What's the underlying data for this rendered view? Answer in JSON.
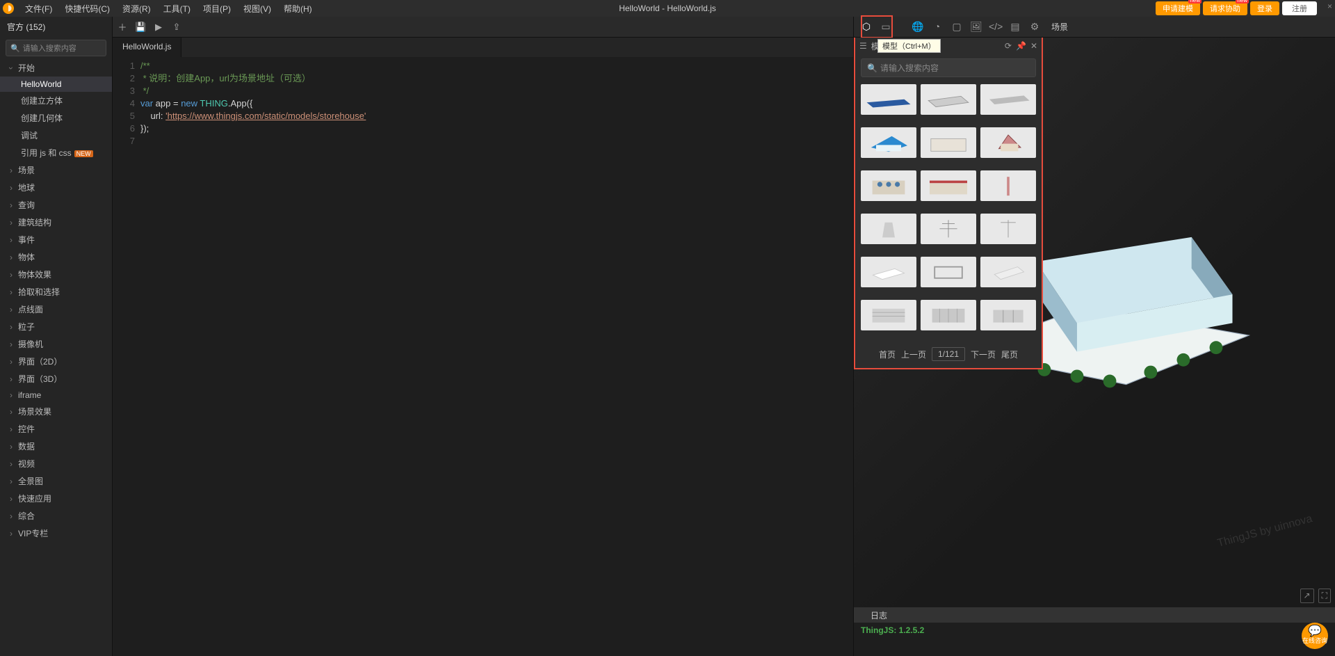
{
  "menubar": {
    "items": [
      "文件(F)",
      "快捷代码(C)",
      "资源(R)",
      "工具(T)",
      "项目(P)",
      "视图(V)",
      "帮助(H)"
    ],
    "title": "HelloWorld - HelloWorld.js",
    "btns": {
      "model": "申请建模",
      "help": "请求协助",
      "login": "登录",
      "signup": "注册",
      "new": "new"
    }
  },
  "sidebar": {
    "top": "官方 (152)",
    "search_ph": "请输入搜索内容",
    "begin_label": "开始",
    "begin_children": [
      {
        "label": "HelloWorld",
        "selected": true
      },
      {
        "label": "创建立方体"
      },
      {
        "label": "创建几何体"
      },
      {
        "label": "调试"
      },
      {
        "label": "引用 js 和 css",
        "new": true
      }
    ],
    "groups": [
      "场景",
      "地球",
      "查询",
      "建筑结构",
      "事件",
      "物体",
      "物体效果",
      "拾取和选择",
      "点线面",
      "粒子",
      "摄像机",
      "界面（2D）",
      "界面（3D）",
      "iframe",
      "场景效果",
      "控件",
      "数据",
      "视频",
      "全景图",
      "快速应用",
      "综合",
      "VIP专栏"
    ]
  },
  "editor": {
    "tab": "HelloWorld.js",
    "lines": [
      "1",
      "2",
      "3",
      "4",
      "5",
      "6",
      "7"
    ],
    "code": {
      "c1": "/**",
      "c2": " * 说明：创建App，url为场景地址（可选）",
      "c3": " */",
      "k_var": "var",
      "v_app": " app = ",
      "k_new": "new",
      "v_thing": " THING",
      "v_app2": ".App({",
      "v_url": "    url: ",
      "s_url": "'https://www.thingjs.com/static/models/storehouse'",
      "v_close": "});"
    }
  },
  "scene": {
    "label": "场景",
    "log_tab": "日志",
    "log_line": "ThingJS: 1.2.5.2",
    "watermark": "ThingJS by uinnova"
  },
  "panel": {
    "title": "模型",
    "tooltip": "模型（Ctrl+M）",
    "search_ph": "请输入搜索内容",
    "pager": {
      "first": "首页",
      "prev": "上一页",
      "page": "1/121",
      "next": "下一页",
      "last": "尾页"
    }
  },
  "fab": "在线咨询"
}
